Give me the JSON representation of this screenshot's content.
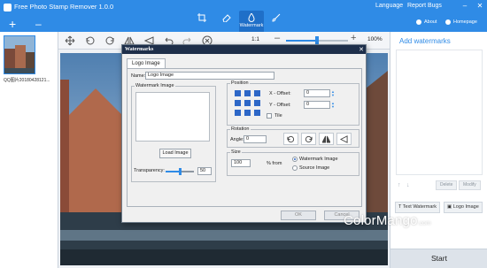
{
  "app": {
    "title": "Free Photo Stamp Remover 1.0.0",
    "menu": {
      "language": "Language",
      "report_bugs": "Report Bugs"
    },
    "window_controls": {
      "minimize": "–",
      "close": "✕"
    },
    "about": "About",
    "homepage": "Homepage",
    "active_mode": "Watermark",
    "modes": [
      "crop-icon",
      "eraser-icon",
      "Watermark",
      "brush-icon"
    ]
  },
  "file_bar": {
    "add": "+",
    "remove": "–"
  },
  "file_list": {
    "items": [
      {
        "name": "QQ图片20180428121..."
      }
    ]
  },
  "toolbar": {
    "zoom_ratio": "1:1",
    "zoom_minus": "–",
    "zoom_plus": "+",
    "zoom_percent": "100%",
    "zoom_level": 0.5
  },
  "right_panel": {
    "title": "Add watermarks",
    "delete_label": "Delete",
    "modify_label": "Modify",
    "text_watermark_label": "Text Watermark",
    "logo_image_label": "Logo Image",
    "start_label": "Start"
  },
  "dialog": {
    "title": "Watermarks",
    "close": "✕",
    "tab": "Logo Image",
    "name_label": "Name:",
    "name_value": "Logo Image",
    "watermark_image_label": "Watermark Image",
    "load_image_label": "Load Image",
    "transparency_label": "Transparency:",
    "transparency_value": "50",
    "position": {
      "label": "Position",
      "x_offset_label": "X - Offset:",
      "x_offset_value": "0",
      "y_offset_label": "Y - Offset:",
      "y_offset_value": "0",
      "tile_label": "Tile"
    },
    "rotation": {
      "label": "Rotation",
      "angle_label": "Angle:",
      "angle_value": "0"
    },
    "size": {
      "label": "Size",
      "value": "100",
      "percent_from": "% from",
      "option_watermark": "Watermark Image",
      "option_source": "Source Image",
      "selected": "Watermark Image"
    },
    "ok_label": "OK",
    "cancel_label": "Cancel"
  },
  "logo_text": {
    "main": "ColorMango",
    "suffix": ".com"
  },
  "colors": {
    "accent": "#2f8be6",
    "dialog_title": "#1e2f4a",
    "grid": "#2d67c7"
  }
}
